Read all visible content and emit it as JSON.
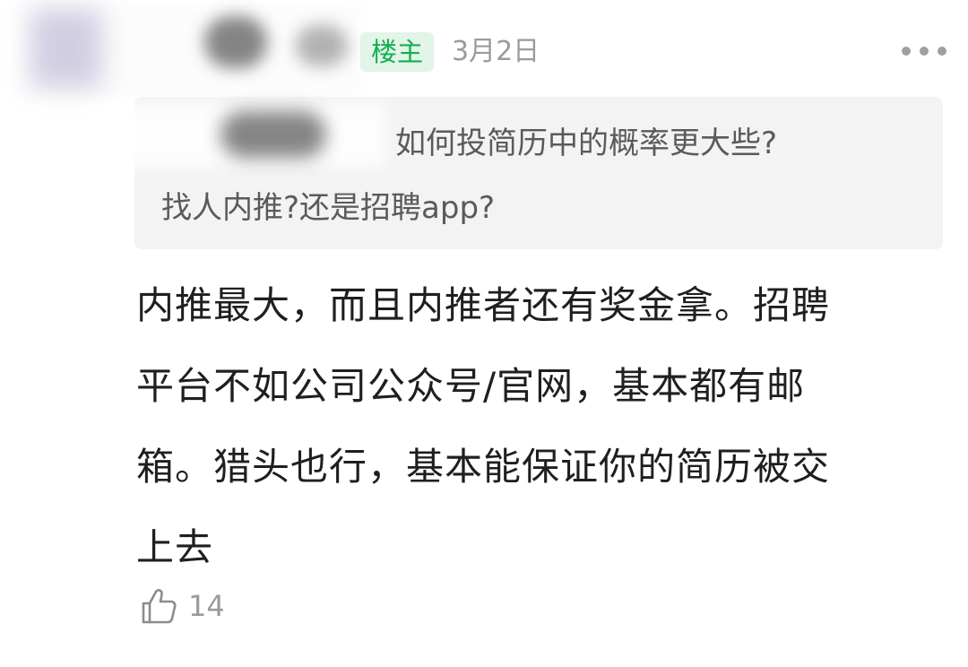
{
  "post": {
    "owner_badge": "楼主",
    "date": "3月2日"
  },
  "quote": {
    "line1": "如何投简历中的概率更大些?",
    "line2": "找人内推?还是招聘app?"
  },
  "reply": {
    "lines": [
      "内推最大，而且内推者还有奖金拿。招聘",
      "平台不如公司公众号/官网，基本都有邮",
      "箱。猎头也行，基本能保证你的简历被交",
      "上去"
    ]
  },
  "like": {
    "count": "14",
    "icon": "thumbs-up-icon"
  },
  "colors": {
    "badge_text": "#12b04f",
    "badge_bg": "#e3f4e8",
    "meta_gray": "#9b9b9b",
    "quote_bg": "#f3f3f3"
  }
}
